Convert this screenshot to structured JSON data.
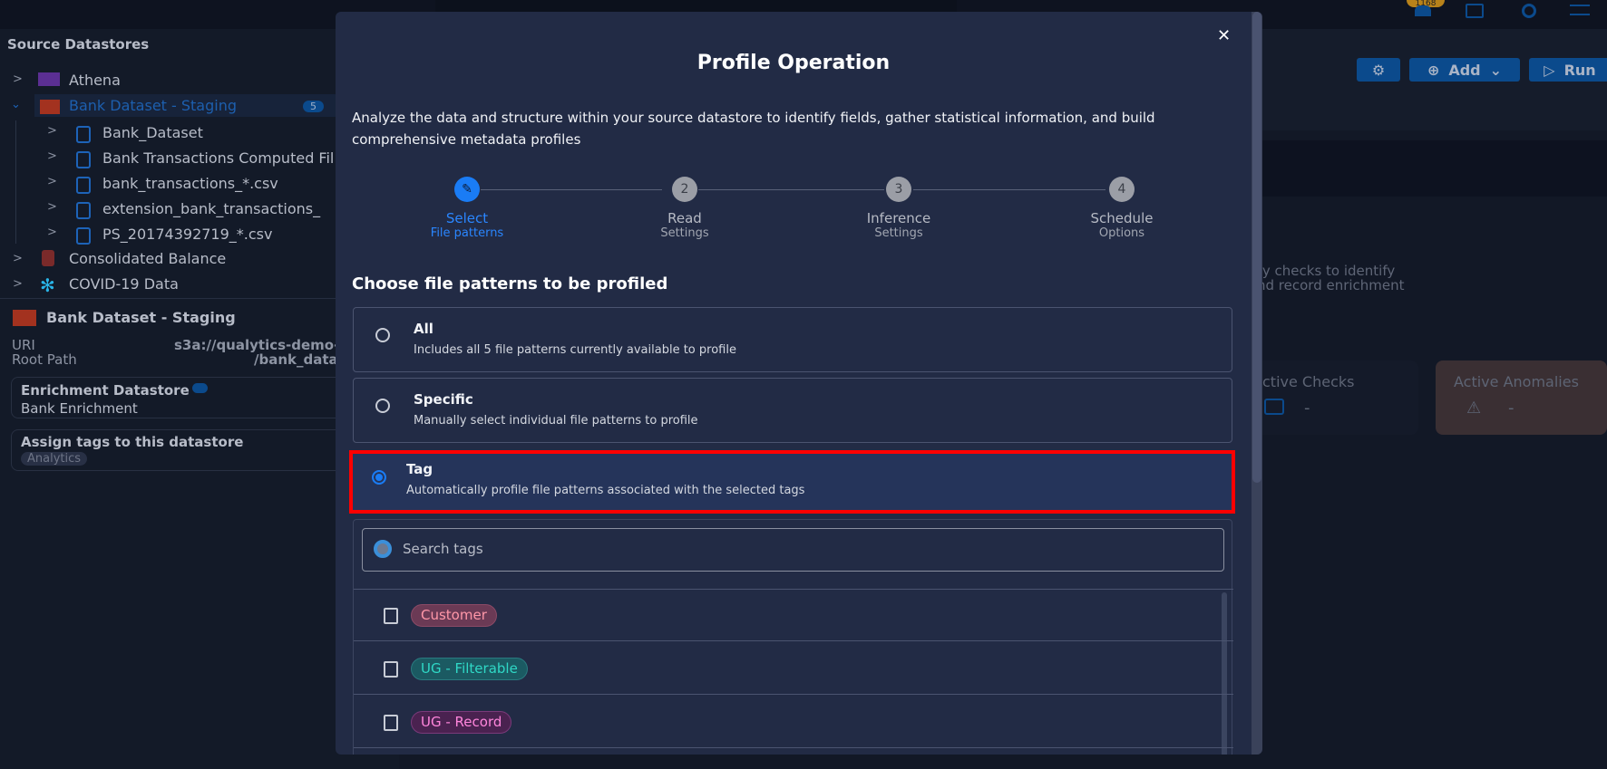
{
  "header": {
    "notification_count": "1168",
    "icons": [
      "bell-icon",
      "document-icon",
      "settings-icon",
      "list-icon"
    ]
  },
  "sidebar": {
    "title": "Source Datastores",
    "datastores": [
      {
        "label": "Athena"
      },
      {
        "label": "Bank Dataset - Staging",
        "count": "5",
        "children": [
          "Bank_Dataset",
          "Bank Transactions Computed Fil",
          "bank_transactions_*.csv",
          "extension_bank_transactions_",
          "PS_20174392719_*.csv"
        ]
      },
      {
        "label": "Consolidated Balance"
      },
      {
        "label": "COVID-19 Data"
      }
    ],
    "details": {
      "name": "Bank Dataset - Staging",
      "uri_label": "URI",
      "uri_value": "s3a://qualytics-demo-",
      "root_label": "Root Path",
      "root_value": "/bank_data",
      "enrichment_label": "Enrichment Datastore",
      "enrichment_value": "Bank Enrichment",
      "tags_label": "Assign tags to this datastore",
      "tag": "Analytics"
    }
  },
  "toolbar": {
    "add": "Add",
    "run": "Run"
  },
  "background": {
    "desc1": "ty checks to identify",
    "desc2": "nd record enrichment",
    "card1": "ctive Checks",
    "card1_value": "-",
    "card2": "Active Anomalies",
    "card2_value": "-"
  },
  "modal": {
    "title": "Profile Operation",
    "description": "Analyze the data and structure within your source datastore to identify fields, gather statistical information, and build comprehensive metadata profiles",
    "steps": [
      {
        "n": "1",
        "l1": "Select",
        "l2": "File patterns",
        "active": true
      },
      {
        "n": "2",
        "l1": "Read",
        "l2": "Settings"
      },
      {
        "n": "3",
        "l1": "Inference",
        "l2": "Settings"
      },
      {
        "n": "4",
        "l1": "Schedule",
        "l2": "Options"
      }
    ],
    "section_title": "Choose file patterns to be profiled",
    "options": [
      {
        "title": "All",
        "sub": "Includes all 5 file patterns currently available to profile",
        "selected": false
      },
      {
        "title": "Specific",
        "sub": "Manually select individual file patterns to profile",
        "selected": false
      },
      {
        "title": "Tag",
        "sub": "Automatically profile file patterns associated with the selected tags",
        "selected": true
      }
    ],
    "search_placeholder": "Search tags",
    "tags": [
      {
        "label": "Customer",
        "color": "#ff8fa0"
      },
      {
        "label": "UG - Filterable",
        "color": "#2fd1c0"
      },
      {
        "label": "UG - Record",
        "color": "#ff7fd6"
      }
    ],
    "highlight_color": "#ff0000",
    "accent": "#1a7cf5"
  }
}
